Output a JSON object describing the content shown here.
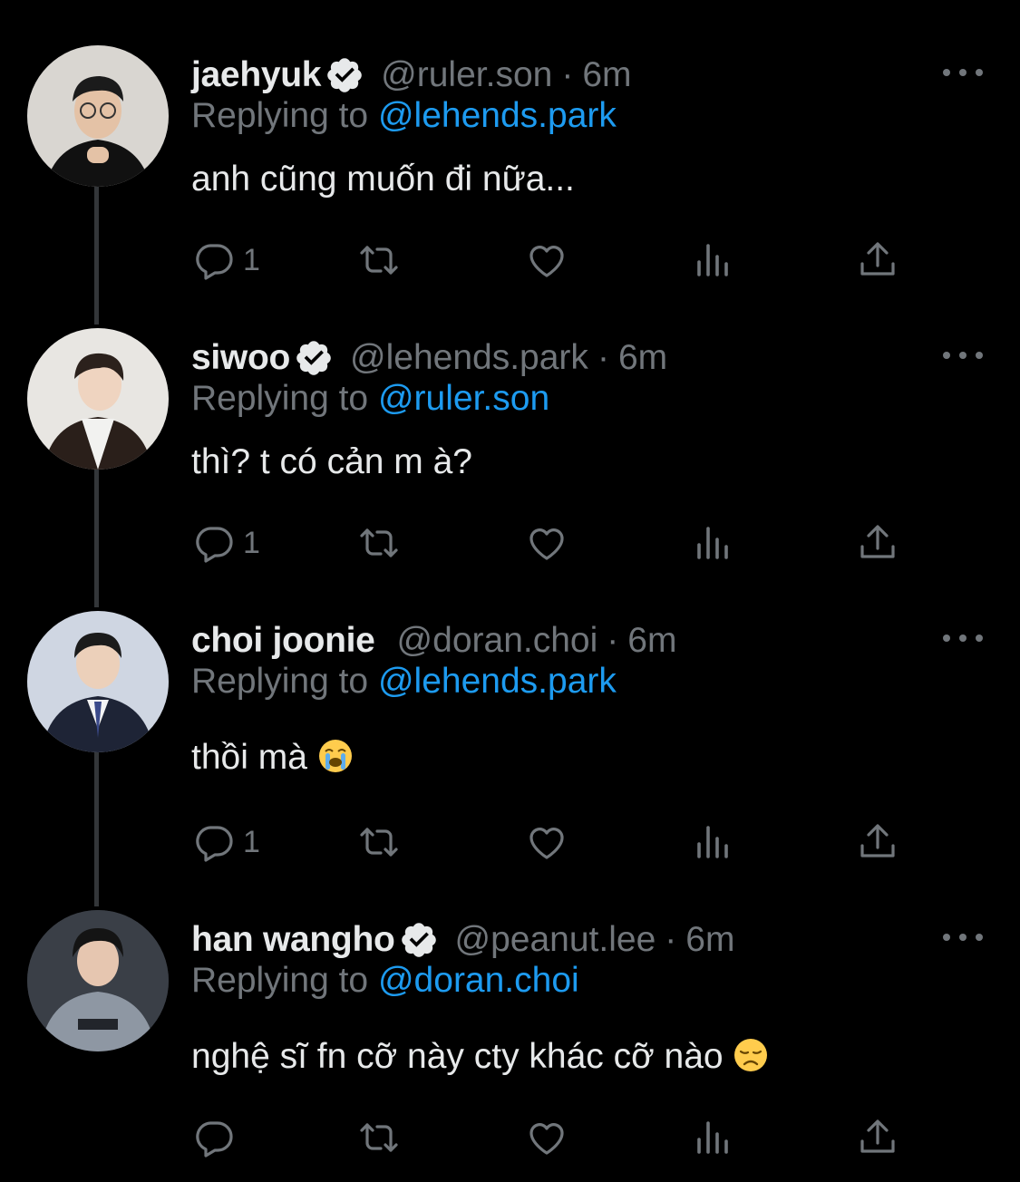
{
  "icons": {
    "more": "more-horizontal-icon",
    "verified": "verified-badge-icon",
    "reply": "reply-icon",
    "retweet": "retweet-icon",
    "like": "heart-icon",
    "views": "views-icon",
    "share": "share-icon"
  },
  "colors": {
    "background": "#000000",
    "accent": "#1d9bf0",
    "muted": "#71767b",
    "text": "#e7e9ea"
  },
  "tweets": [
    {
      "name": "jaehyuk",
      "verified": true,
      "handle": "@ruler.son",
      "dot": "·",
      "time": "6m",
      "replying_prefix": "Replying to",
      "replying_to": "@lehends.park",
      "text": "anh cũng muốn đi nữa...",
      "reply_count": "1"
    },
    {
      "name": "siwoo",
      "verified": true,
      "handle": "@lehends.park",
      "dot": "·",
      "time": "6m",
      "replying_prefix": "Replying to",
      "replying_to": "@ruler.son",
      "text": "thì? t có cản m à?",
      "reply_count": "1"
    },
    {
      "name": "choi joonie",
      "verified": false,
      "handle": "@doran.choi",
      "dot": "·",
      "time": "6m",
      "replying_prefix": "Replying to",
      "replying_to": "@lehends.park",
      "text": "thồi mà",
      "emoji": "loudly-crying-face-emoji",
      "reply_count": "1"
    },
    {
      "name": "han wangho",
      "verified": true,
      "handle": "@peanut.lee",
      "dot": "·",
      "time": "6m",
      "replying_prefix": "Replying to",
      "replying_to": "@doran.choi",
      "text": "nghệ sĩ fn cỡ này cty khác cỡ nào",
      "emoji": "disappointed-face-emoji",
      "reply_count": ""
    }
  ]
}
